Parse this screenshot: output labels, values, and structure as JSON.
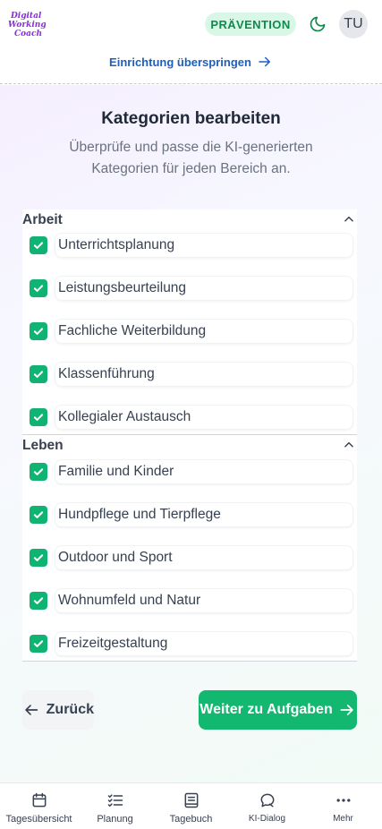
{
  "header": {
    "logo_text": "Digital Working Coach",
    "badge": "PRÄVENTION",
    "avatar_initials": "TU",
    "skip_label": "Einrichtung überspringen"
  },
  "page": {
    "title": "Kategorien bearbeiten",
    "subtitle": "Überprüfe und passe die KI-generierten Kategorien für jeden Bereich an."
  },
  "sections": [
    {
      "name": "Arbeit",
      "items": [
        {
          "label": "Unterrichtsplanung",
          "checked": true
        },
        {
          "label": "Leistungsbeurteilung",
          "checked": true
        },
        {
          "label": "Fachliche Weiterbildung",
          "checked": true
        },
        {
          "label": "Klassenführung",
          "checked": true
        },
        {
          "label": "Kollegialer Austausch",
          "checked": true
        }
      ]
    },
    {
      "name": "Leben",
      "items": [
        {
          "label": "Familie und Kinder",
          "checked": true
        },
        {
          "label": "Hundpflege und Tierpflege",
          "checked": true
        },
        {
          "label": "Outdoor und Sport",
          "checked": true
        },
        {
          "label": "Wohnumfeld und Natur",
          "checked": true
        },
        {
          "label": "Freizeitgestaltung",
          "checked": true
        }
      ]
    }
  ],
  "actions": {
    "back_label": "Zurück",
    "next_label": "Weiter zu Aufgaben"
  },
  "nav": [
    {
      "label": "Tagesübersicht",
      "icon": "calendar-icon"
    },
    {
      "label": "Planung",
      "icon": "checklist-icon"
    },
    {
      "label": "Tagebuch",
      "icon": "book-icon"
    },
    {
      "label": "KI-Dialog",
      "icon": "chat-icon"
    },
    {
      "label": "Mehr",
      "icon": "more-icon"
    }
  ],
  "colors": {
    "accent_green": "#12b870",
    "link_blue": "#1d5fbf",
    "badge_bg": "#d9f7e6",
    "logo_purple": "#8b2be2"
  }
}
